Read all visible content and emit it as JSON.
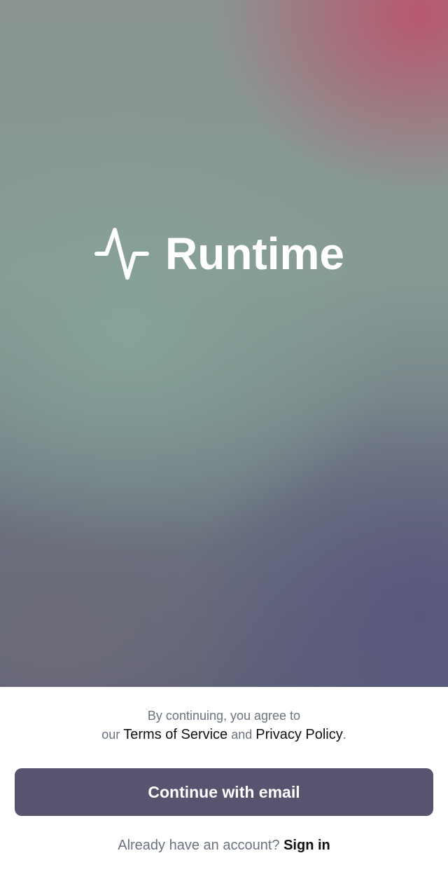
{
  "brand": {
    "name": "Runtime",
    "icon": "pulse-wave-icon"
  },
  "legal": {
    "line1": "By continuing, you agree to",
    "prefix": "our",
    "terms_link": "Terms of Service",
    "conjunction": "and",
    "privacy_link": "Privacy Policy",
    "suffix": "."
  },
  "cta": {
    "label": "Continue with email"
  },
  "signin": {
    "prompt": "Already have an account?",
    "link": "Sign in"
  },
  "colors": {
    "button_bg": "#585470",
    "link_text": "#111111",
    "muted_text": "#6b7280",
    "hero_accent_pink": "#ba546c",
    "hero_accent_teal": "#86a49a",
    "hero_accent_indigo": "#58567e"
  }
}
